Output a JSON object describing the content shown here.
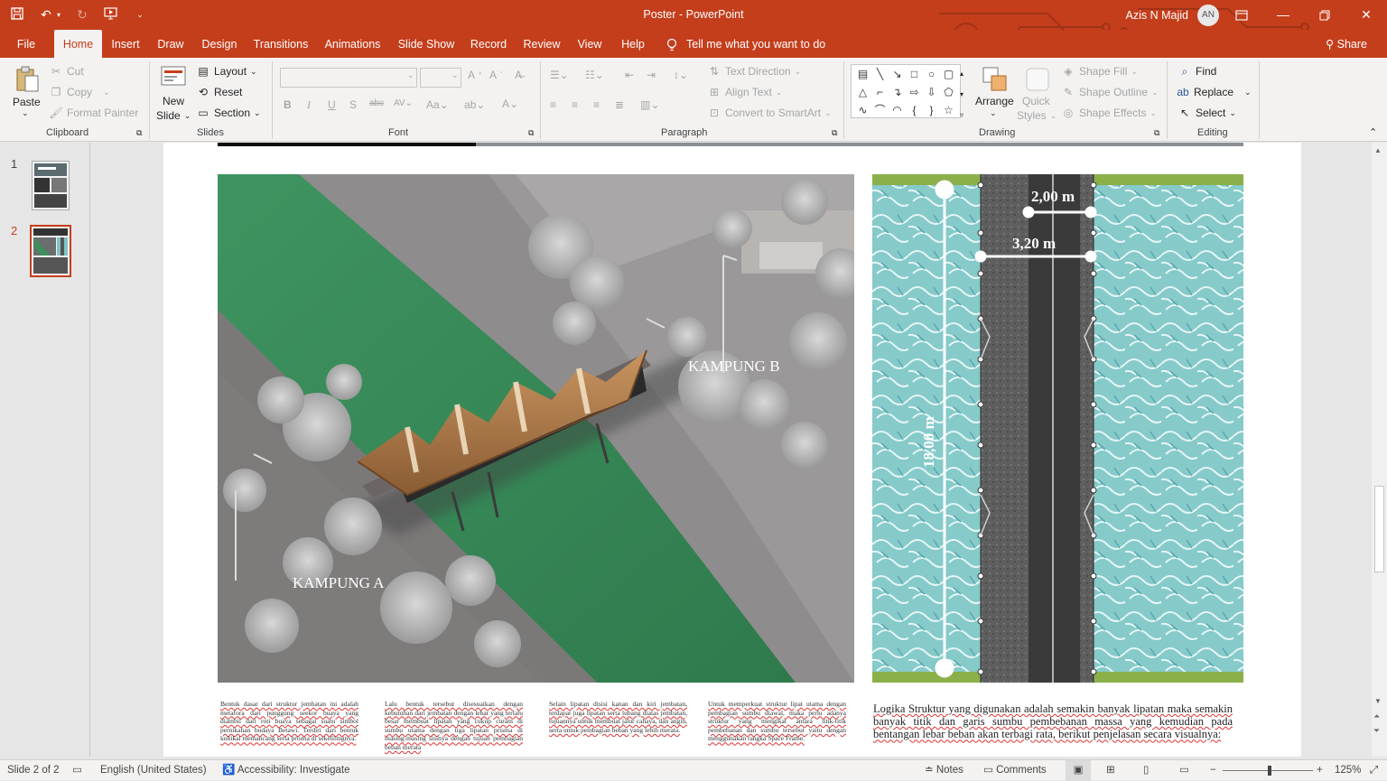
{
  "titlebar": {
    "title": "Poster  -  PowerPoint",
    "user_name": "Azis N Majid",
    "avatar_initials": "AN"
  },
  "tabs": [
    {
      "label": "File"
    },
    {
      "label": "Home"
    },
    {
      "label": "Insert"
    },
    {
      "label": "Draw"
    },
    {
      "label": "Design"
    },
    {
      "label": "Transitions"
    },
    {
      "label": "Animations"
    },
    {
      "label": "Slide Show"
    },
    {
      "label": "Record"
    },
    {
      "label": "Review"
    },
    {
      "label": "View"
    },
    {
      "label": "Help"
    }
  ],
  "tell_me": "Tell me what you want to do",
  "share": "Share",
  "ribbon": {
    "clipboard": {
      "paste": "Paste",
      "cut": "Cut",
      "copy": "Copy",
      "format_painter": "Format Painter",
      "label": "Clipboard"
    },
    "slides": {
      "new_slide": "New",
      "new_slide2": "Slide",
      "layout": "Layout",
      "reset": "Reset",
      "section": "Section",
      "label": "Slides"
    },
    "font": {
      "label": "Font"
    },
    "paragraph": {
      "text_direction": "Text Direction",
      "align_text": "Align Text",
      "convert_smartart": "Convert to SmartArt",
      "label": "Paragraph"
    },
    "drawing": {
      "arrange": "Arrange",
      "quick_styles": "Quick",
      "quick_styles2": "Styles",
      "shape_fill": "Shape Fill",
      "shape_outline": "Shape Outline",
      "shape_effects": "Shape Effects",
      "label": "Drawing"
    },
    "editing": {
      "find": "Find",
      "replace": "Replace",
      "select": "Select",
      "label": "Editing"
    }
  },
  "slides_panel": [
    {
      "number": "1"
    },
    {
      "number": "2"
    }
  ],
  "slide": {
    "kampung_b": "KAMPUNG  B",
    "kampung_a": "KAMPUNG  A",
    "dim_2": "2,00 m",
    "dim_3": "3,20 m",
    "dim_18": "18,00 m",
    "paragraphs": [
      "Bentuk dasar dari struktur jembatan ini adalah metafora dari punggung seekor buaya yang diambil dari roti buaya sebagai suatu simbol pernikahan budaya Betawi. Terdiri dari bentuk kubikal memancang serta prisma di sekelilingnya.",
      "Lalu bentuk tersebut disesuaikan dengan kebutuhan dari jembatan dengan lebar yang terlalu besar membuat lipatan yang cukup curam di sumbu utama dengan tiga lipatan prisma di masing-masing sisinya dengan tujuan pembagian beban merata",
      "Selain lipatan disisi kanan dan kiri jembatan, terdapat juga lipatan serta lubang diatas jembatan, tujuannya untuk membuat jalur cahaya, dan angin, serta untuk pembagian beban yang lebih merata.",
      "Untuk memperkuat struktur lipat utama dengan pembagian sumbu diawal, maka perlu adanya struktur yang mengikat antara titik-titik pembebanan dan sumbu tersebut yaitu dengan menggunakan rangka Space Frame."
    ],
    "logika": "Logika Struktur yang digunakan adalah semakin banyak lipatan maka semakin banyak titik dan garis sumbu pembebanan massa yang kemudian pada bentangan lebar beban akan terbagi rata, berikut penjelasan secara visualnya:"
  },
  "status": {
    "slide_of": "Slide 2 of 2",
    "language": "English (United States)",
    "accessibility": "Accessibility: Investigate",
    "notes": "Notes",
    "comments": "Comments",
    "zoom": "125%"
  },
  "colors": {
    "accent": "#c43e1c",
    "river_green": "#3d8f5e",
    "water": "#7fc4c4",
    "grass": "#8bb04a"
  }
}
